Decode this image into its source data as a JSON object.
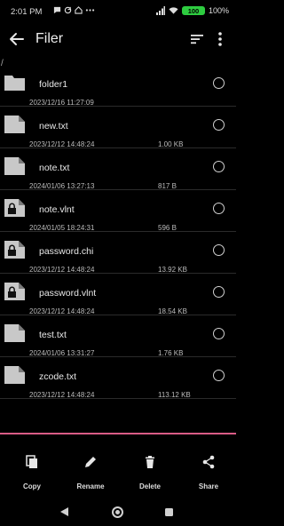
{
  "status": {
    "time": "2:01 PM",
    "battery": "100",
    "battery_percent": "100%",
    "icons": [
      "messaging-icon",
      "sync-icon",
      "home-icon",
      "more-dots-icon"
    ]
  },
  "appbar": {
    "title": "Filer"
  },
  "path": "/",
  "files": [
    {
      "name": "folder1",
      "date": "2023/12/16 11:27:09",
      "size": "",
      "type": "folder-icon"
    },
    {
      "name": "new.txt",
      "date": "2023/12/12 14:48:24",
      "size": "1.00 KB",
      "type": "file-icon"
    },
    {
      "name": "note.txt",
      "date": "2024/01/06 13:27:13",
      "size": "817 B",
      "type": "file-icon"
    },
    {
      "name": "note.vlnt",
      "date": "2024/01/05 18:24:31",
      "size": "596 B",
      "type": "locked-file-icon"
    },
    {
      "name": "password.chi",
      "date": "2023/12/12 14:48:24",
      "size": "13.92 KB",
      "type": "locked-file-icon"
    },
    {
      "name": "password.vlnt",
      "date": "2023/12/12 14:48:24",
      "size": "18.54 KB",
      "type": "locked-file-icon"
    },
    {
      "name": "test.txt",
      "date": "2024/01/06 13:31:27",
      "size": "1.76 KB",
      "type": "file-icon"
    },
    {
      "name": "zcode.txt",
      "date": "2023/12/12 14:48:24",
      "size": "113.12 KB",
      "type": "file-icon"
    }
  ],
  "actions": [
    {
      "label": "Copy",
      "icon": "copy-icon"
    },
    {
      "label": "Rename",
      "icon": "pencil-icon"
    },
    {
      "label": "Delete",
      "icon": "trash-icon"
    },
    {
      "label": "Share",
      "icon": "share-icon"
    }
  ],
  "colors": {
    "accent_bar": "#d95c86",
    "background": "#000000",
    "battery": "#2ecc40"
  }
}
